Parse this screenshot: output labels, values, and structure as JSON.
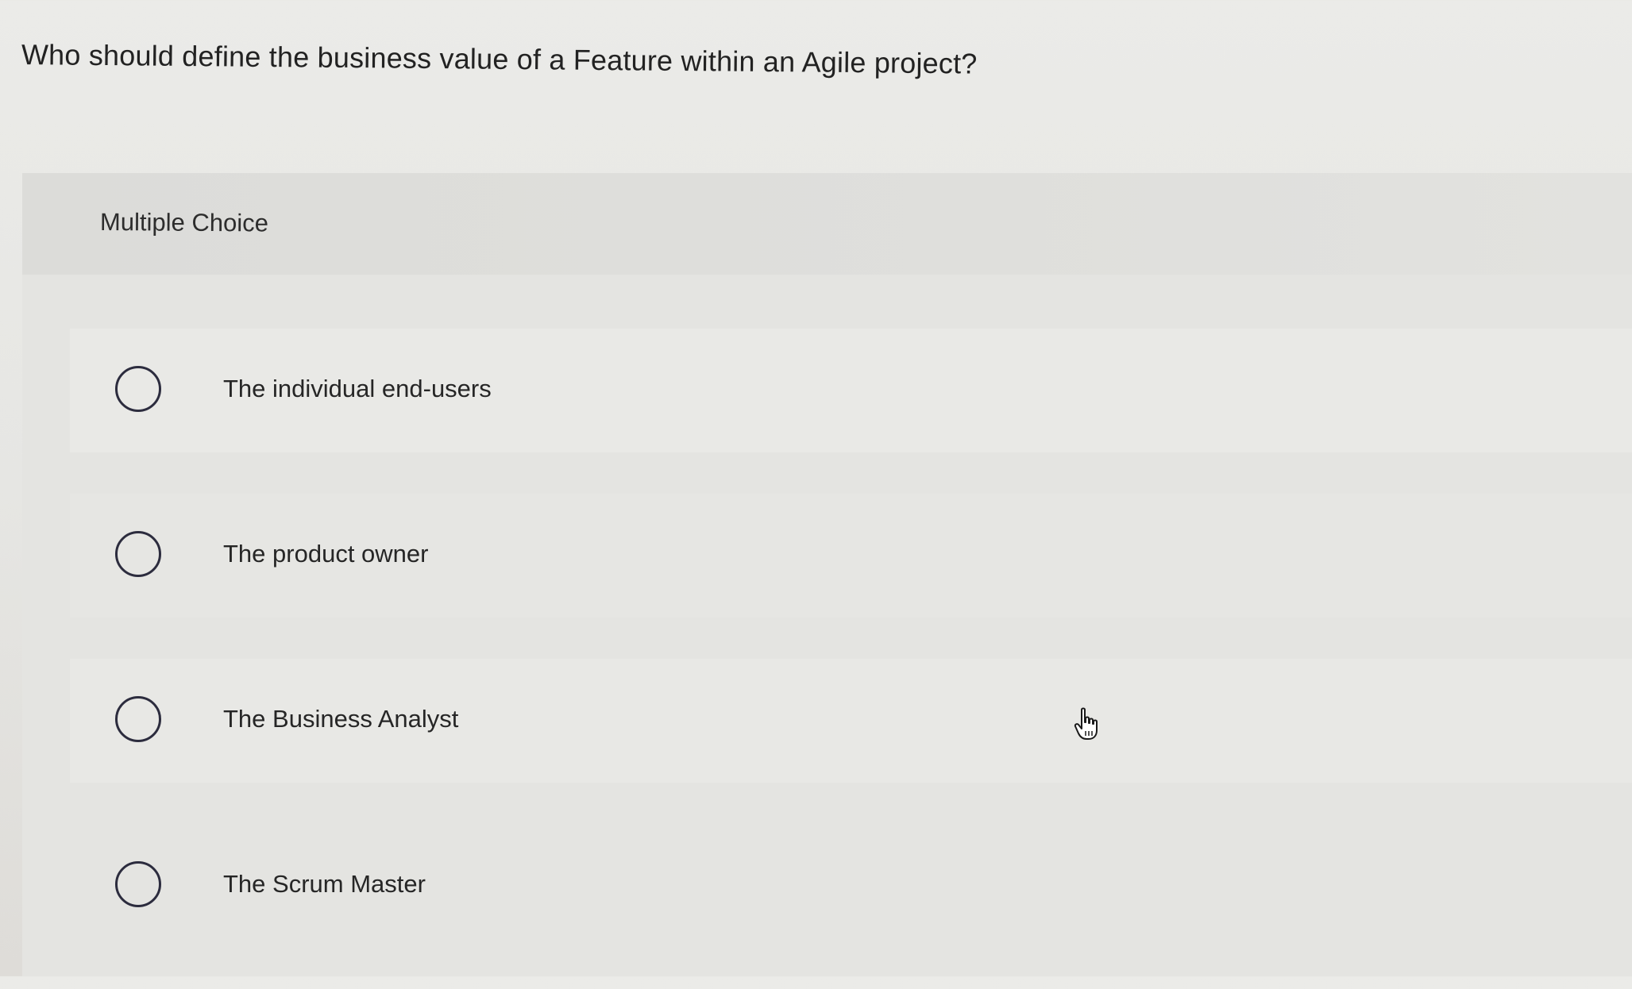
{
  "question": {
    "text": "Who should define the business value of a Feature within an Agile project?"
  },
  "panel": {
    "type_label": "Multiple Choice"
  },
  "options": [
    {
      "label": "The individual end-users",
      "selected": false
    },
    {
      "label": "The product owner",
      "selected": false
    },
    {
      "label": "The Business Analyst",
      "selected": false
    },
    {
      "label": "The Scrum Master",
      "selected": false
    }
  ],
  "cursor": {
    "icon": "hand-pointer-icon"
  }
}
